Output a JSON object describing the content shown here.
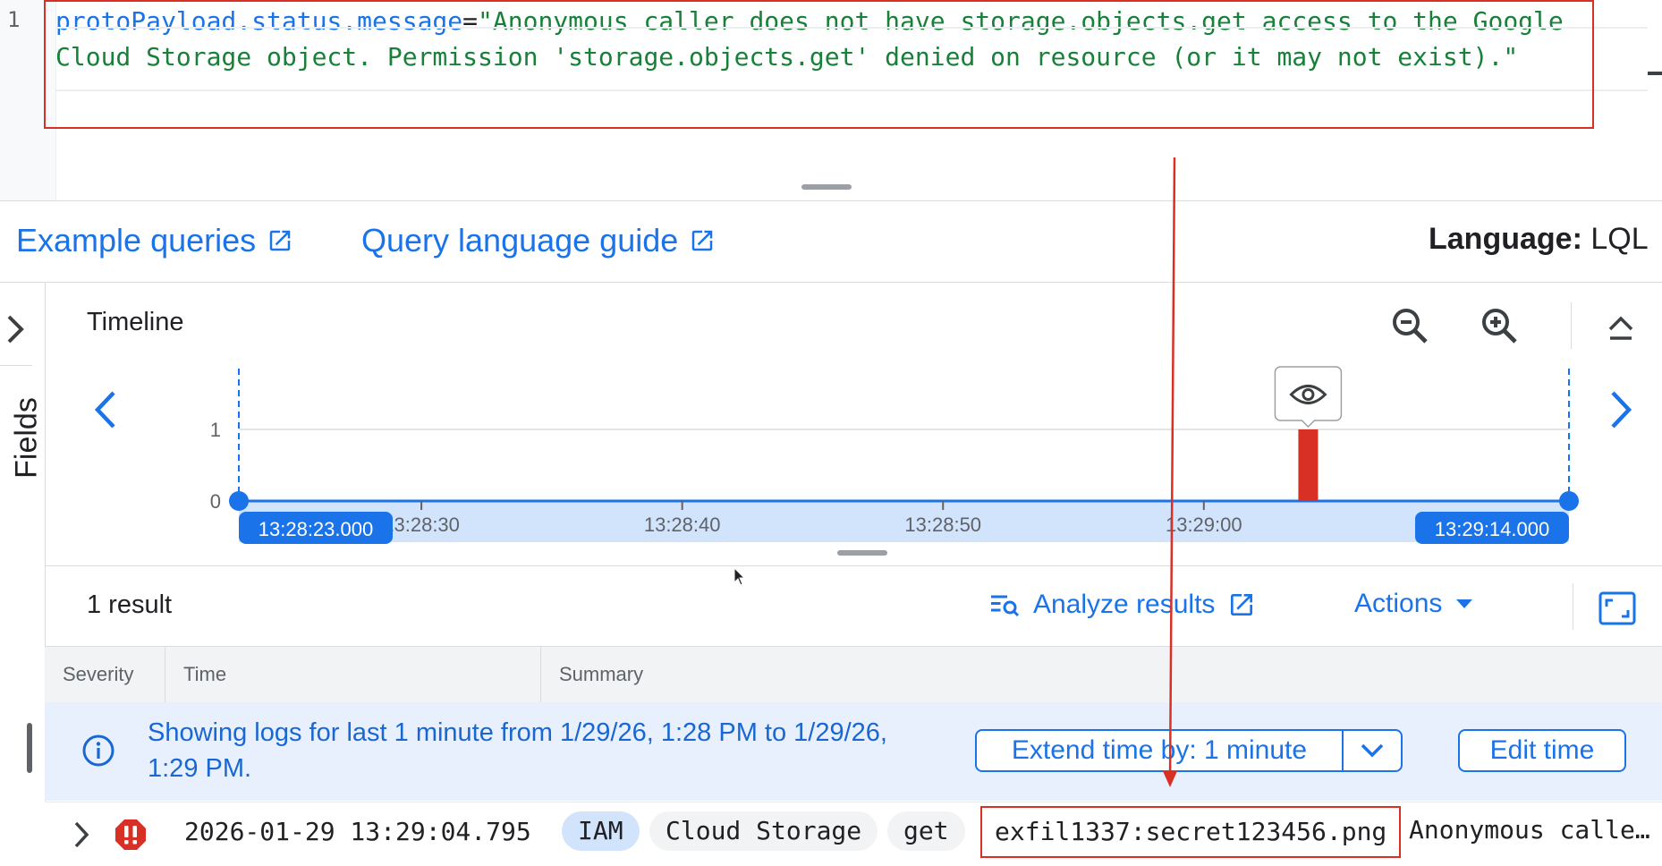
{
  "editor": {
    "line_number": "1",
    "query_field": "protoPayload.status.message",
    "query_operator": "=",
    "query_value": "\"Anonymous caller does not have storage.objects.get access to the Google Cloud Storage object. Permission 'storage.objects.get' denied on resource (or it may not exist).\""
  },
  "links": {
    "example_queries": "Example queries",
    "query_language_guide": "Query language guide",
    "language_label": "Language:",
    "language_value": "LQL"
  },
  "rail": {
    "fields_label": "Fields"
  },
  "timeline": {
    "title": "Timeline",
    "start_label": "13:28:23.000",
    "end_label": "13:29:14.000"
  },
  "chart_data": {
    "type": "bar",
    "x_ticks": [
      "13:28:30",
      "13:28:40",
      "13:28:50",
      "13:29:00"
    ],
    "y_ticks": [
      "0",
      "1"
    ],
    "x_range": [
      "13:28:23.000",
      "13:29:14.000"
    ],
    "ylim": [
      0,
      1
    ],
    "series": [
      {
        "x": [
          "13:29:04"
        ],
        "values": [
          1
        ],
        "color": "#d93025"
      }
    ],
    "grid": true,
    "marker_icon": "eye-icon"
  },
  "results": {
    "count": "1 result",
    "analyze": "Analyze results",
    "actions": "Actions"
  },
  "table": {
    "columns": [
      "Severity",
      "Time",
      "Summary"
    ]
  },
  "banner": {
    "message": "Showing logs for last 1 minute from 1/29/26, 1:28 PM to 1/29/26, 1:29 PM.",
    "extend_label": "Extend time by: 1 minute",
    "edit_time_label": "Edit time"
  },
  "log_entry": {
    "severity": "error",
    "timestamp": "2026-01-29 13:29:04.795",
    "chips": [
      "IAM",
      "Cloud Storage",
      "get"
    ],
    "resource": "exfil1337:secret123456.png",
    "summary": "Anonymous calle…"
  },
  "colors": {
    "accent": "#1a73e8",
    "query_string": "#188038",
    "error": "#d93025",
    "banner_bg": "#e8f0fe"
  }
}
